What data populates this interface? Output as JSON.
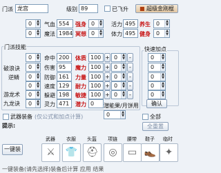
{
  "top": {
    "sect_label": "门派",
    "sect_value": "龙宫",
    "level_label": "级别",
    "level_value": "89",
    "ascended_label": "已飞升",
    "chaoyuan_button": "超级金刚棍"
  },
  "base_stats": [
    {
      "left_value": "0",
      "label": "气血",
      "value": "554",
      "attr": "强身",
      "spin": "0"
    },
    {
      "left_value": "0",
      "label": "魔法",
      "value": "1984",
      "attr": "冥想",
      "spin": "0"
    }
  ],
  "right_stats": [
    {
      "label": "活力",
      "value": "495",
      "attr": "养生",
      "spin": "0"
    },
    {
      "label": "体力",
      "value": "495",
      "attr": "健身",
      "spin": "0"
    }
  ],
  "skills": {
    "group_title": "门派技能",
    "skill_names": [
      "破浪诀",
      "逆鳞",
      "游龙术",
      "九龙诀"
    ],
    "skill_values": [
      "0",
      "0",
      "0",
      "0",
      "0",
      "0"
    ],
    "combat_labels": [
      "命中",
      "伤害",
      "防御",
      "速度",
      "躲避",
      "灵力"
    ],
    "combat_values": [
      "200",
      "95",
      "161",
      "129",
      "198",
      "471"
    ],
    "attr_labels": [
      "体质",
      "魔力",
      "力量",
      "耐力",
      "敏捷",
      "潜力"
    ],
    "attr_values": [
      "100",
      "100",
      "100",
      "100",
      "100",
      "0"
    ],
    "attr_spins": [
      "0",
      "0",
      "0",
      "0",
      "0"
    ]
  },
  "quick_add": {
    "title": "快速加点",
    "values": [
      "0",
      "0",
      "0",
      "0",
      "0"
    ],
    "confirm": "确认"
  },
  "bottom": {
    "weapon_check": "武器装备",
    "formula_note": "(仅公式和加点计算)",
    "hint_label": "提示:",
    "bingrest_label": "潜能果/月饼用",
    "bingrest_value": "0",
    "reset_label": "全部",
    "reset_button": "全重置"
  },
  "equipment_labels": [
    "武器",
    "衣服",
    "头盔",
    "项链",
    "腰带",
    "鞋子",
    "临时"
  ],
  "equipment_icons": [
    "⚔",
    "👕",
    "⛑",
    "◎",
    "▭",
    "👞",
    "✦"
  ],
  "one_key_button": "一键装",
  "footer_text": "一键装备(请先选择)装备后计算 应用 结果"
}
